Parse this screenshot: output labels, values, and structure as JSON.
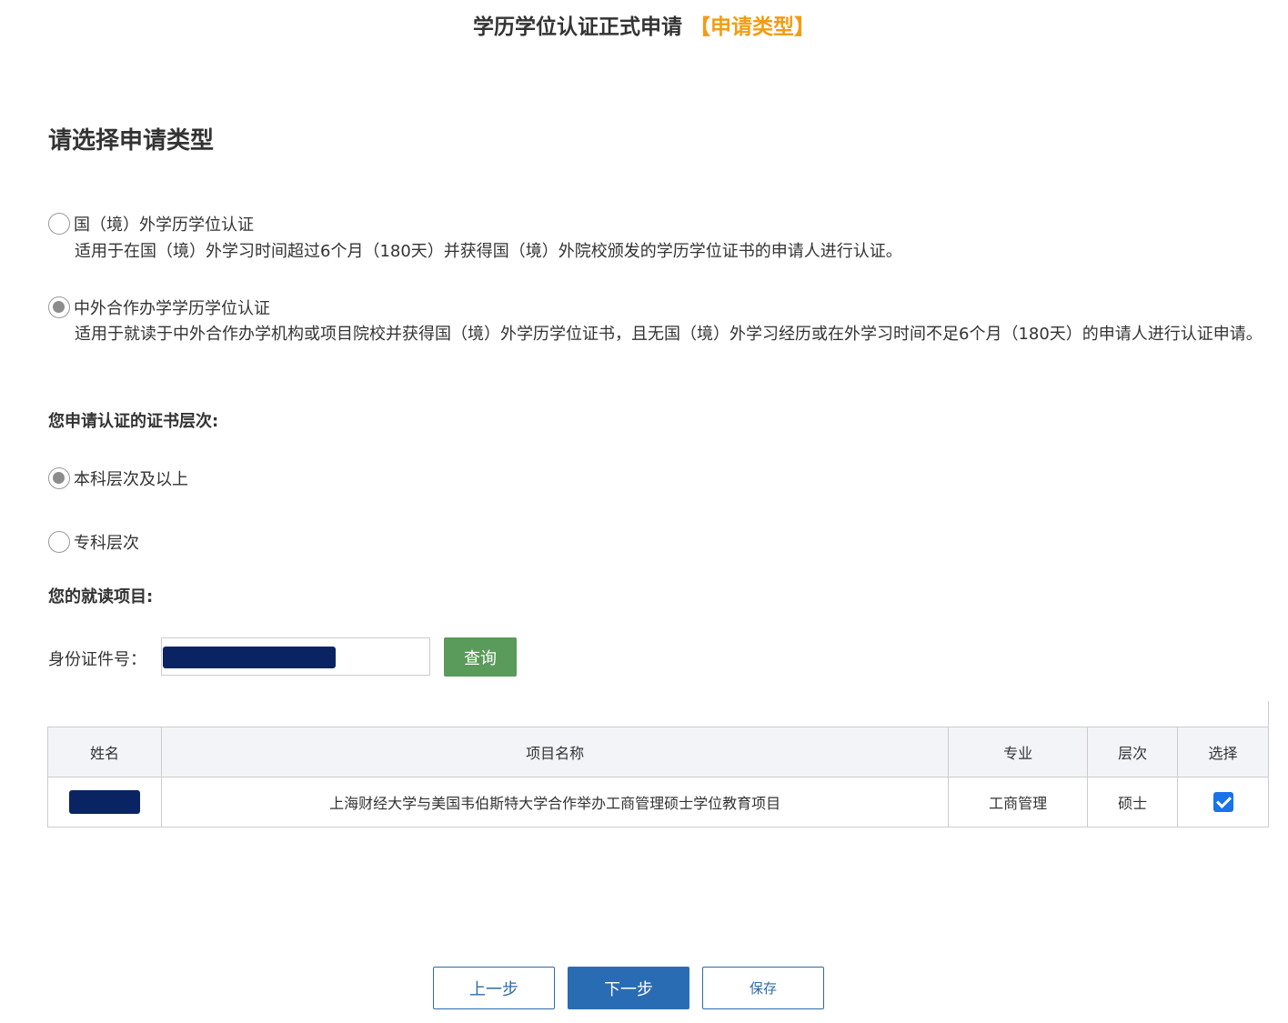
{
  "header": {
    "title": "学历学位认证正式申请",
    "title_accent": "【申请类型】"
  },
  "section_title": "请选择申请类型",
  "application_types": [
    {
      "label": "国（境）外学历学位认证",
      "description": "适用于在国（境）外学习时间超过6个月（180天）并获得国（境）外院校颁发的学历学位证书的申请人进行认证。",
      "selected": false
    },
    {
      "label": "中外合作办学学历学位认证",
      "description": "适用于就读于中外合作办学机构或项目院校并获得国（境）外学历学位证书，且无国（境）外学习经历或在外学习时间不足6个月（180天）的申请人进行认证申请。",
      "selected": true
    }
  ],
  "certificate_level": {
    "label": "您申请认证的证书层次:",
    "options": [
      {
        "label": "本科层次及以上",
        "selected": true
      },
      {
        "label": "专科层次",
        "selected": false
      }
    ]
  },
  "program": {
    "label": "您的就读项目:",
    "id_label": "身份证件号：",
    "query_button": "查询"
  },
  "table": {
    "headers": [
      "姓名",
      "项目名称",
      "专业",
      "层次",
      "选择"
    ],
    "rows": [
      {
        "project": "上海财经大学与美国韦伯斯特大学合作举办工商管理硕士学位教育项目",
        "major": "工商管理",
        "level": "硕士",
        "checked": true
      }
    ]
  },
  "footer": {
    "prev_button": "上一步",
    "next_button": "下一步",
    "save_button": "保存"
  },
  "colors": {
    "accent": "#f39c12",
    "primary": "#2a6cb3",
    "query": "#5a9a5a",
    "redaction": "#0a2463"
  }
}
